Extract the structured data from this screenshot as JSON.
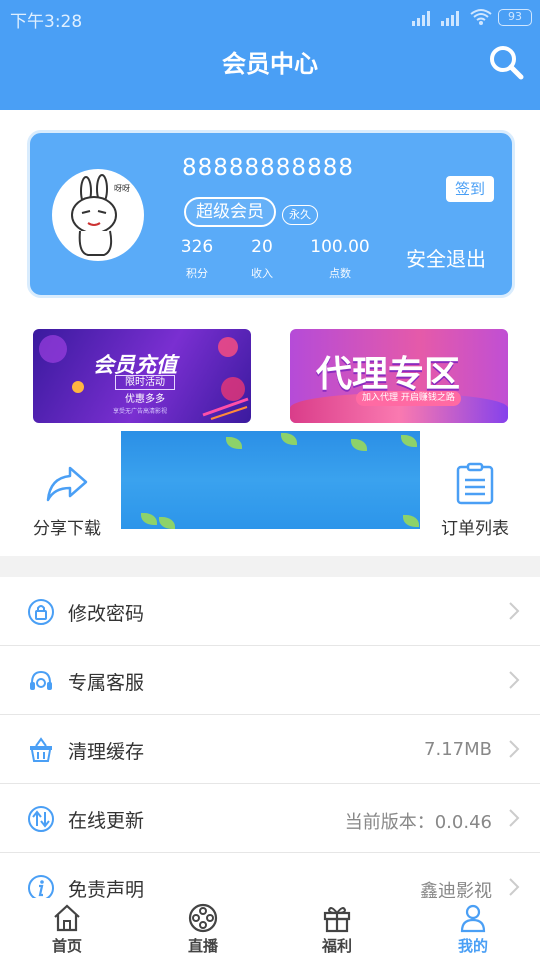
{
  "status_bar": {
    "time": "下午3:28",
    "battery": "93"
  },
  "header": {
    "title": "会员中心"
  },
  "user_card": {
    "user_id": "88888888888",
    "vip_label": "超级会员",
    "vip_duration": "永久",
    "signin_label": "签到",
    "stats": [
      {
        "value": "326",
        "label": "积分"
      },
      {
        "value": "20",
        "label": "收入"
      },
      {
        "value": "100.00",
        "label": "点数"
      }
    ],
    "logout_label": "安全退出"
  },
  "banners": {
    "recharge": {
      "title": "会员充值",
      "line1": "限时活动",
      "line2": "优惠多多",
      "note": "享受无广告高清影视"
    },
    "agent": {
      "title": "代理专区",
      "note": "加入代理 开启赚钱之路"
    }
  },
  "tools": {
    "share": {
      "label": "分享下载"
    },
    "orders": {
      "label": "订单列表"
    }
  },
  "menu": [
    {
      "label": "修改密码",
      "value": ""
    },
    {
      "label": "专属客服",
      "value": ""
    },
    {
      "label": "清理缓存",
      "value": "7.17MB"
    },
    {
      "label": "在线更新",
      "value": "当前版本：0.0.46"
    },
    {
      "label": "免责声明",
      "value": "鑫迪影视"
    }
  ],
  "tabbar": [
    {
      "label": "首页",
      "icon": "home-icon"
    },
    {
      "label": "直播",
      "icon": "film-reel-icon"
    },
    {
      "label": "福利",
      "icon": "gift-icon"
    },
    {
      "label": "我的",
      "icon": "user-icon",
      "active": true
    }
  ],
  "colors": {
    "primary": "#4a9ff5",
    "card": "#5aabf8"
  }
}
